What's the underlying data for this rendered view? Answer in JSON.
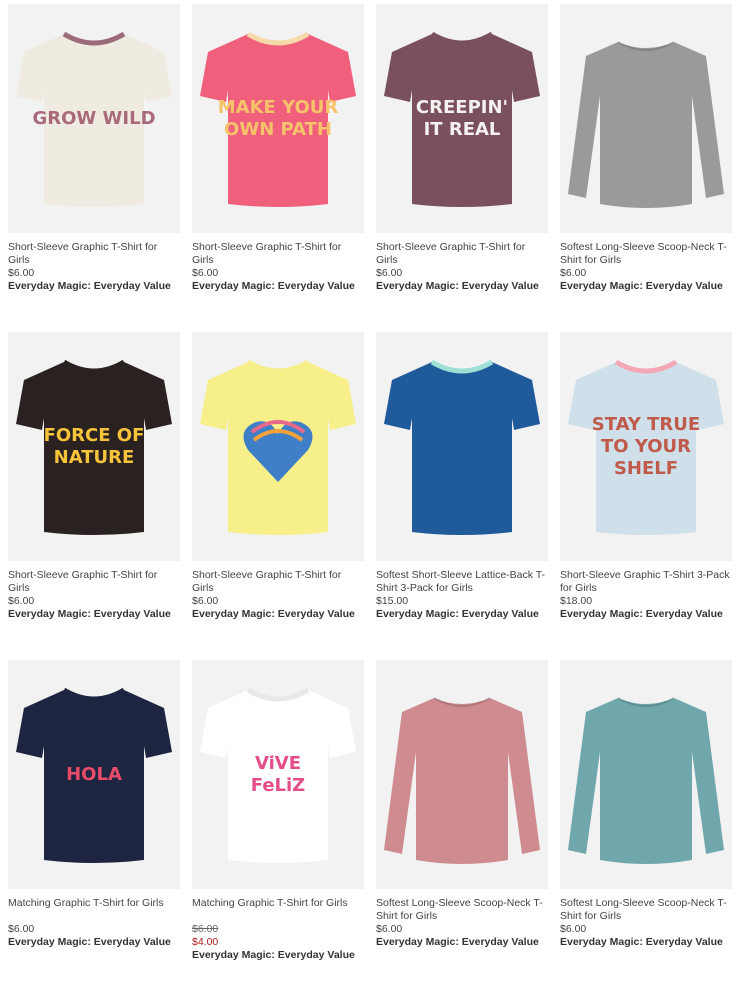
{
  "products": [
    {
      "name": "Short-Sleeve Graphic T-Shirt for Girls",
      "price": "$6.00",
      "old_price": "",
      "sale_price": "",
      "promo": "Everyday Magic: Everyday Value",
      "colors": {
        "body": "#f0ebe0",
        "trim": "#9b6b7a"
      },
      "graphic": "GROW WILD",
      "graphic_color": "#a86a7a"
    },
    {
      "name": "Short-Sleeve Graphic T-Shirt for Girls",
      "price": "$6.00",
      "old_price": "",
      "sale_price": "",
      "promo": "Everyday Magic: Everyday Value",
      "colors": {
        "body": "#f0607c",
        "trim": "#f6d9a8"
      },
      "graphic": "MAKE YOUR OWN PATH",
      "graphic_color": "#f6c36a"
    },
    {
      "name": "Short-Sleeve Graphic T-Shirt for Girls",
      "price": "$6.00",
      "old_price": "",
      "sale_price": "",
      "promo": "Everyday Magic: Everyday Value",
      "colors": {
        "body": "#7a5060",
        "trim": "#7a5060"
      },
      "graphic": "CREEPIN' IT REAL",
      "graphic_color": "#f4f1ee"
    },
    {
      "name": "Softest Long-Sleeve Scoop-Neck T-Shirt for Girls",
      "price": "$6.00",
      "old_price": "",
      "sale_price": "",
      "promo": "Everyday Magic: Everyday Value",
      "colors": {
        "body": "#9a9a9a",
        "trim": "#9a9a9a"
      },
      "graphic": "",
      "graphic_color": ""
    },
    {
      "name": "Short-Sleeve Graphic T-Shirt for Girls",
      "price": "$6.00",
      "old_price": "",
      "sale_price": "",
      "promo": "Everyday Magic: Everyday Value",
      "colors": {
        "body": "#2a2220",
        "trim": "#2a2220"
      },
      "graphic": "FORCE OF NATURE",
      "graphic_color": "#f7c33a"
    },
    {
      "name": "Short-Sleeve Graphic T-Shirt for Girls",
      "price": "$6.00",
      "old_price": "",
      "sale_price": "",
      "promo": "Everyday Magic: Everyday Value",
      "colors": {
        "body": "#f6ef8a",
        "trim": "#f6ef8a"
      },
      "graphic": "",
      "graphic_color": "#5aa6dc"
    },
    {
      "name": "Softest Short-Sleeve Lattice-Back T-Shirt 3-Pack for Girls",
      "price": "$15.00",
      "old_price": "",
      "sale_price": "",
      "promo": "Everyday Magic: Everyday Value",
      "colors": {
        "body": "#1f5a9a",
        "trim": "#9fe0d6"
      },
      "graphic": "",
      "graphic_color": ""
    },
    {
      "name": "Short-Sleeve Graphic T-Shirt 3-Pack for Girls",
      "price": "$18.00",
      "old_price": "",
      "sale_price": "",
      "promo": "Everyday Magic: Everyday Value",
      "colors": {
        "body": "#cfe0ea",
        "trim": "#f4a8b6"
      },
      "graphic": "STAY TRUE TO YOUR SHELF",
      "graphic_color": "#c05a4a"
    },
    {
      "name": "Matching Graphic T-Shirt for Girls",
      "price": "$6.00",
      "old_price": "",
      "sale_price": "",
      "promo": "Everyday Magic: Everyday Value",
      "colors": {
        "body": "#1d2540",
        "trim": "#1d2540"
      },
      "graphic": "HOLA",
      "graphic_color": "#e94b6a"
    },
    {
      "name": "Matching Graphic T-Shirt for Girls",
      "price": "",
      "old_price": "$6.00",
      "sale_price": "$4.00",
      "promo": "Everyday Magic: Everyday Value",
      "colors": {
        "body": "#ffffff",
        "trim": "#e8e8e8"
      },
      "graphic": "ViVE FeLiZ",
      "graphic_color": "#e44d8a"
    },
    {
      "name": "Softest Long-Sleeve Scoop-Neck T-Shirt for Girls",
      "price": "$6.00",
      "old_price": "",
      "sale_price": "",
      "promo": "Everyday Magic: Everyday Value",
      "colors": {
        "body": "#cf8c90",
        "trim": "#cf8c90"
      },
      "graphic": "",
      "graphic_color": ""
    },
    {
      "name": "Softest Long-Sleeve Scoop-Neck T-Shirt for Girls",
      "price": "$6.00",
      "old_price": "",
      "sale_price": "",
      "promo": "Everyday Magic: Everyday Value",
      "colors": {
        "body": "#6fa7ad",
        "trim": "#6fa7ad"
      },
      "graphic": "",
      "graphic_color": ""
    }
  ]
}
